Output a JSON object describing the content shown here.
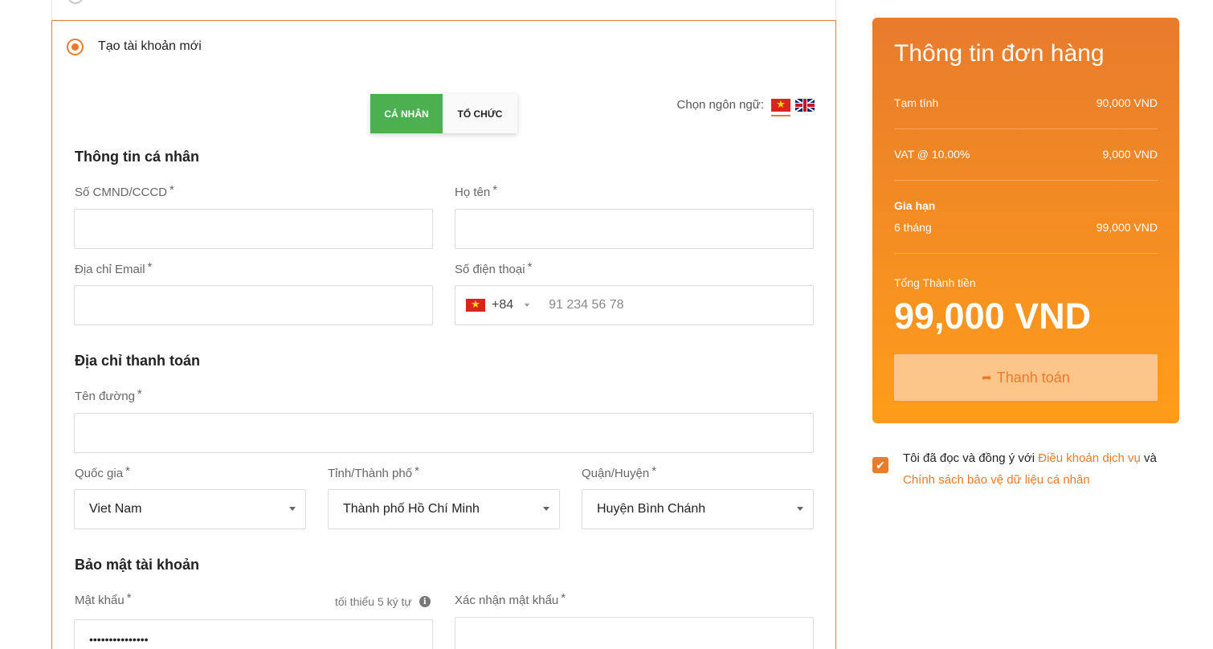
{
  "account_option": {
    "label": "Tạo tài khoản mới"
  },
  "account_type": {
    "individual": "CÁ NHÂN",
    "organization": "TỔ CHỨC"
  },
  "language": {
    "label": "Chọn ngôn ngữ:",
    "selected": "vietnamese-flag-icon",
    "options": [
      "vietnamese-flag-icon",
      "uk-flag-icon"
    ]
  },
  "personal": {
    "title": "Thông tin cá nhân",
    "id_label": "Số CMND/CCCD",
    "id_value": "",
    "name_label": "Họ tên",
    "name_value": "",
    "email_label": "Địa chỉ Email",
    "email_value": "",
    "phone_label": "Số điện thoại",
    "phone_code": "+84",
    "phone_placeholder": "91 234 56 78"
  },
  "billing": {
    "title": "Địa chỉ thanh toán",
    "street_label": "Tên đường",
    "street_value": "",
    "country_label": "Quốc gia",
    "country_value": "Viet Nam",
    "province_label": "Tỉnh/Thành phố",
    "province_value": "Thành phố Hồ Chí Minh",
    "district_label": "Quận/Huyện",
    "district_value": "Huyện Bình Chánh"
  },
  "security": {
    "title": "Bảo mật tài khoản",
    "password_label": "Mật khẩu",
    "password_hint": "tối thiểu 5 ký tự",
    "password_value": "•••••••••••••••",
    "confirm_label": "Xác nhận mật khẩu",
    "confirm_value": ""
  },
  "required_mark": "*",
  "order": {
    "title": "Thông tin đơn hàng",
    "subtotal_label": "Tạm tính",
    "subtotal_value": "90,000 VND",
    "vat_label": "VAT @ 10.00%",
    "vat_value": "9,000 VND",
    "renewal_label": "Gia hạn",
    "renewal_period": "6 tháng",
    "renewal_value": "99,000 VND",
    "total_label": "Tổng Thành tiền",
    "total_value": "99,000 VND",
    "pay_label": "Thanh toán"
  },
  "agreement": {
    "checked": true,
    "text_before": "Tôi đã đọc và đồng ý với ",
    "terms_link": "Điều khoản dịch vụ",
    "text_middle": " và ",
    "privacy_link": "Chính sách bảo vệ dữ liệu cá nhân"
  },
  "colors": {
    "accent": "#e87b2c",
    "success": "#4caf50"
  }
}
